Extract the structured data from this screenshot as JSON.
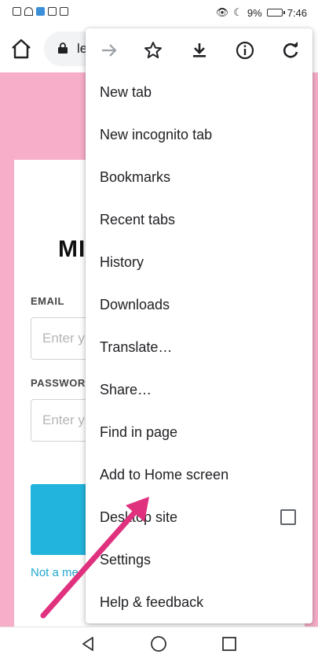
{
  "status_bar": {
    "battery": "9%",
    "time": "7:46"
  },
  "toolbar": {
    "url_text": "le"
  },
  "page": {
    "logo_text": "MI",
    "email_label": "EMAIL",
    "email_placeholder": "Enter y",
    "password_label": "PASSWORD",
    "password_placeholder": "Enter y",
    "not_member_text": "Not a me"
  },
  "menu": {
    "items": [
      {
        "label": "New tab"
      },
      {
        "label": "New incognito tab"
      },
      {
        "label": "Bookmarks"
      },
      {
        "label": "Recent tabs"
      },
      {
        "label": "History"
      },
      {
        "label": "Downloads"
      },
      {
        "label": "Translate…"
      },
      {
        "label": "Share…"
      },
      {
        "label": "Find in page"
      },
      {
        "label": "Add to Home screen"
      },
      {
        "label": "Desktop site"
      },
      {
        "label": "Settings"
      },
      {
        "label": "Help & feedback"
      }
    ]
  },
  "colors": {
    "page_background": "#f7aec8",
    "login_button": "#22b4dc",
    "arrow": "#e0317f"
  }
}
